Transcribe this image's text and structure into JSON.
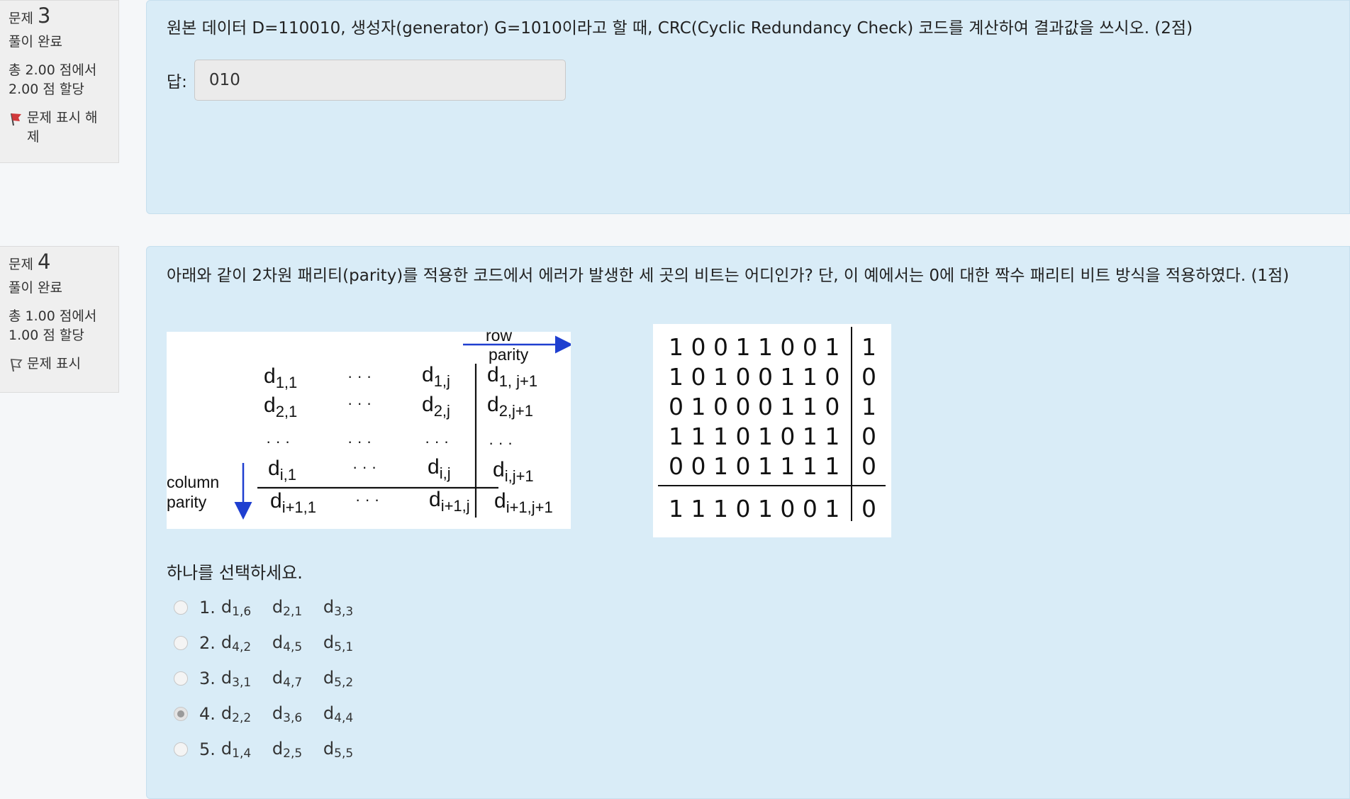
{
  "q3": {
    "label": "문제",
    "number": "3",
    "state": "풀이 완료",
    "grade_line1": "총 2.00 점에서",
    "grade_line2": "2.00 점 할당",
    "flag_label": "문제 표시 해제",
    "flag_icon": "flag-filled-icon",
    "flag_color": "#d0393b",
    "text": "원본 데이터 D=110010, 생성자(generator) G=1010이라고 할 때, CRC(Cyclic Redundancy Check) 코드를 계산하여 결과값을 쓰시오. (2점)",
    "answer_label": "답:",
    "answer_value": "010"
  },
  "q4": {
    "label": "문제",
    "number": "4",
    "state": "풀이 완료",
    "grade_line1": "총 1.00 점에서",
    "grade_line2": "1.00 점 할당",
    "flag_label": "문제 표시",
    "flag_icon": "flag-outline-icon",
    "text": "아래와 같이 2차원 패리티(parity)를 적용한 코드에서 에러가 발생한 세 곳의 비트는 어디인가? 단, 이 예에서는 0에 대한 짝수 패리티 비트 방식을 적용하였다. (1점)",
    "parity_diagram": {
      "row_parity_label": [
        "row",
        "parity"
      ],
      "column_parity_label": [
        "column",
        "parity"
      ],
      "rows": [
        [
          "d",
          "1,1",
          "· · ·",
          "d",
          "1,j",
          "d",
          "1, j+1"
        ],
        [
          "d",
          "2,1",
          "· · ·",
          "d",
          "2,j",
          "d",
          "2,j+1"
        ],
        [
          "· · ·",
          "",
          "· · ·",
          "· · ·",
          "",
          "· · ·",
          ""
        ],
        [
          "d",
          "i,1",
          "· · ·",
          "d",
          "i,j",
          "d",
          "i,j+1"
        ],
        [
          "d",
          "i+1,1",
          "· · ·",
          "d",
          "i+1,j",
          "d",
          "i+1,j+1"
        ]
      ]
    },
    "bit_table": {
      "rows": [
        [
          "1 0 0 1 1 0 0 1",
          "1"
        ],
        [
          "1 0 1 0 0 1 1 0",
          "0"
        ],
        [
          "0 1 0 0 0 1 1 0",
          "1"
        ],
        [
          "1 1 1 0 1 0 1 1",
          "0"
        ],
        [
          "0 0 1 0 1 1 1 1",
          "0"
        ]
      ],
      "parity_row": [
        "1 1 1 0 1 0 0 1",
        "0"
      ]
    },
    "select_prompt": "하나를 선택하세요.",
    "options": [
      {
        "num": "1.",
        "terms": [
          [
            "d",
            "1,6"
          ],
          [
            "d",
            "2,1"
          ],
          [
            "d",
            "3,3"
          ]
        ],
        "selected": false
      },
      {
        "num": "2.",
        "terms": [
          [
            "d",
            "4,2"
          ],
          [
            "d",
            "4,5"
          ],
          [
            "d",
            "5,1"
          ]
        ],
        "selected": false
      },
      {
        "num": "3.",
        "terms": [
          [
            "d",
            "3,1"
          ],
          [
            "d",
            "4,7"
          ],
          [
            "d",
            "5,2"
          ]
        ],
        "selected": false
      },
      {
        "num": "4.",
        "terms": [
          [
            "d",
            "2,2"
          ],
          [
            "d",
            "3,6"
          ],
          [
            "d",
            "4,4"
          ]
        ],
        "selected": true
      },
      {
        "num": "5.",
        "terms": [
          [
            "d",
            "1,4"
          ],
          [
            "d",
            "2,5"
          ],
          [
            "d",
            "5,5"
          ]
        ],
        "selected": false
      }
    ]
  }
}
